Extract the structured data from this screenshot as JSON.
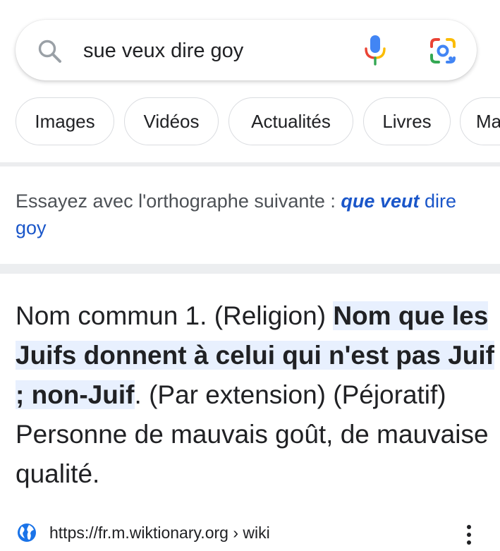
{
  "search": {
    "query": "sue veux dire goy",
    "icons": {
      "left": "search-icon",
      "voice": "mic-icon",
      "lens": "google-lens-icon"
    }
  },
  "chips": [
    {
      "label": "Images"
    },
    {
      "label": "Vidéos"
    },
    {
      "label": "Actualités"
    },
    {
      "label": "Livres"
    },
    {
      "label": "Ma"
    }
  ],
  "spelling": {
    "prefix": "Essayez avec l'orthographe suivante : ",
    "suggestion_bold": "que veut",
    "suggestion_rest": " dire goy"
  },
  "snippet": {
    "before": "Nom commun 1. (Religion) ",
    "highlight": "Nom que les Juifs donnent à celui qui n'est pas Juif ; non-Juif",
    "after": ". (Par extension) (Péjoratif) Personne de mauvais goût, de mauvaise qualité."
  },
  "source": {
    "url": "https://fr.m.wiktionary.org › wiki",
    "icon": "globe-icon"
  },
  "colors": {
    "link": "#1a56c9",
    "highlight_bg": "#e8f0fe",
    "mic_blue": "#4285f4",
    "mic_red": "#ea4335",
    "mic_yellow": "#fbbc04",
    "mic_green": "#34a853"
  }
}
